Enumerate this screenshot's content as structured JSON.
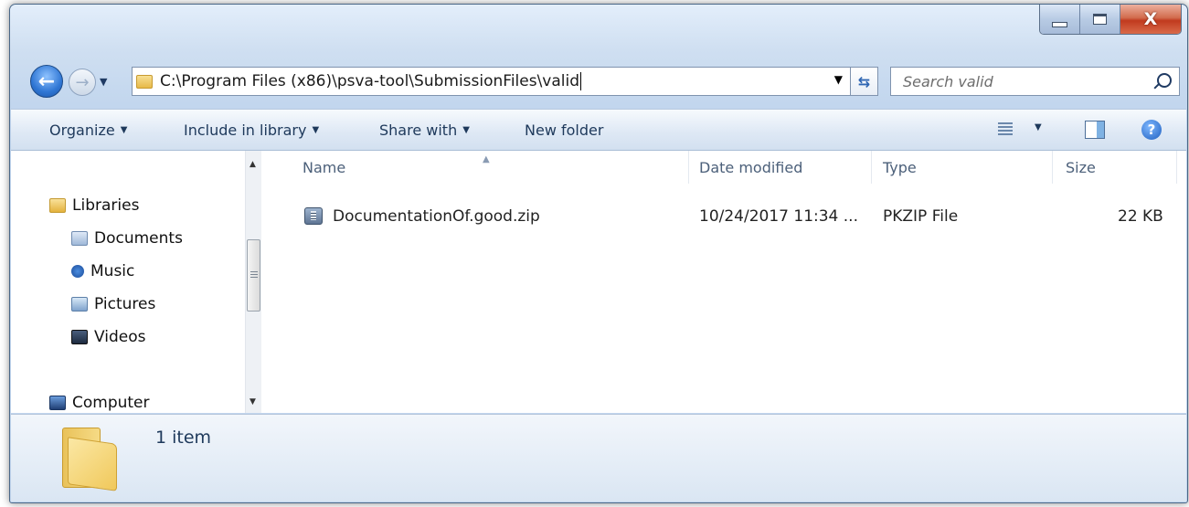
{
  "window": {
    "caption_buttons": {
      "minimize_icon": "minimize-icon",
      "maximize_icon": "maximize-icon",
      "close_label": "X"
    }
  },
  "navigation": {
    "back_icon": "back-arrow-icon",
    "forward_icon": "forward-arrow-icon",
    "address_path": "C:\\Program Files (x86)\\psva-tool\\SubmissionFiles\\valid",
    "search_placeholder": "Search valid"
  },
  "toolbar": {
    "organize": "Organize",
    "include_in_library": "Include in library",
    "share_with": "Share with",
    "new_folder": "New folder"
  },
  "nav_pane": {
    "items": [
      {
        "label": "Libraries",
        "icon": "libraries-icon"
      },
      {
        "label": "Documents",
        "icon": "documents-icon"
      },
      {
        "label": "Music",
        "icon": "music-icon"
      },
      {
        "label": "Pictures",
        "icon": "pictures-icon"
      },
      {
        "label": "Videos",
        "icon": "videos-icon"
      },
      {
        "label": "Computer",
        "icon": "computer-icon"
      }
    ]
  },
  "file_list": {
    "columns": [
      "Name",
      "Date modified",
      "Type",
      "Size"
    ],
    "rows": [
      {
        "name": "DocumentationOf.good.zip",
        "date_modified": "10/24/2017 11:34 ...",
        "type": "PKZIP File",
        "size": "22 KB",
        "icon": "zip-archive-icon"
      }
    ]
  },
  "details_pane": {
    "item_count": "1 item",
    "icon": "folder-icon"
  },
  "colors": {
    "accent": "#1e395b",
    "frame": "#c2d6ee",
    "close": "#c13a1e"
  }
}
